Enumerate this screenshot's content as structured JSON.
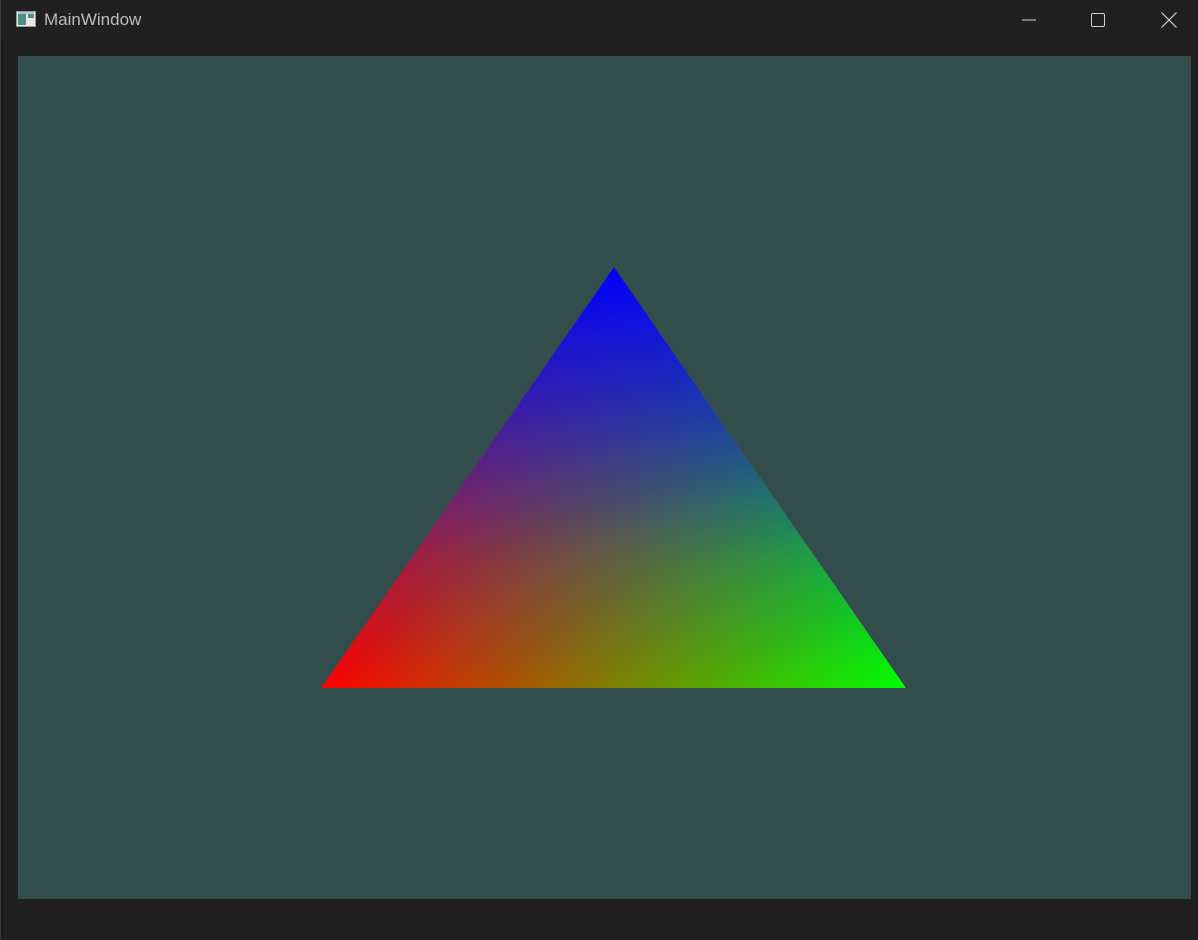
{
  "window": {
    "title": "MainWindow",
    "app_icon": "qt-window-icon",
    "controls": [
      "minimize-icon",
      "maximize-icon",
      "close-icon"
    ]
  },
  "viewport": {
    "clear_color": "#334c4c",
    "shape": "triangle",
    "vertex_colors": {
      "bottom_left": "#ff0000",
      "bottom_right": "#00ff00",
      "top": "#0000ff"
    }
  },
  "colors": {
    "titlebar_bg": "#202020",
    "title_text": "#bdbdbd",
    "icon_stroke": "#cfcfcf"
  }
}
